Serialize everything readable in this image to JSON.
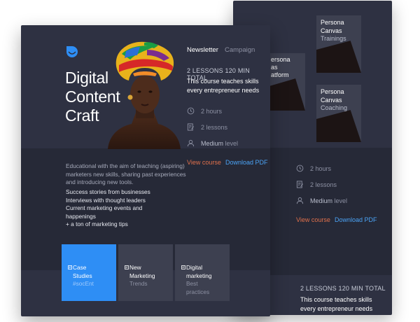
{
  "back_card": {
    "thumbs": [
      {
        "lines": [
          "Persona",
          "Canvas"
        ],
        "sub": "Trainings"
      },
      {
        "lines": [
          "Persona",
          "Canvas"
        ],
        "sub": "Coaching"
      }
    ],
    "partial_thumb": {
      "lines": [
        "ersona",
        "as",
        "atform"
      ]
    },
    "meta": {
      "hours": "2 hours",
      "lessons": "2 lessons",
      "level_prefix": "Medium",
      "level_suffix": "level"
    },
    "links": {
      "view": "View course",
      "download": "Download PDF"
    },
    "info": {
      "label": "2 LESSONS 120 MIN TOTAL",
      "text": "This course teaches skills every entrepreneur needs"
    }
  },
  "front_card": {
    "title": "Digital Content Craft",
    "tabs": [
      {
        "label": "Newsletter",
        "active": true
      },
      {
        "label": "Campaign",
        "active": false
      }
    ],
    "info": {
      "label": "2 LESSONS 120 MIN TOTAL",
      "text": "This course teaches skills every entrepreneur needs"
    },
    "meta": {
      "hours": "2 hours",
      "lessons": "2 lessons",
      "level_prefix": "Medium",
      "level_suffix": "level"
    },
    "links": {
      "view": "View course",
      "download": "Download PDF"
    },
    "description": "Educational with the aim of teaching (aspiring) marketers new skills, sharing past experiences and introducing new tools.",
    "bullets": [
      "Success stories from businesses",
      "Interviews with thought leaders",
      "Current marketing events and",
      "happenings",
      "+ a ton of marketing tips"
    ],
    "tiles": [
      {
        "lines": [
          "Case",
          "Studies"
        ],
        "sub": "#socEnt",
        "active": true
      },
      {
        "lines": [
          "New",
          "Marketing"
        ],
        "sub": "Trends",
        "active": false
      },
      {
        "lines": [
          "Digital",
          "marketing"
        ],
        "sub": "Best practices",
        "active": false
      }
    ]
  },
  "colors": {
    "card_bg": "#2e3142",
    "band_bg": "#262937",
    "tile_bg": "#3d4050",
    "accent_blue": "#2e8ef5",
    "link_orange": "#e0704b",
    "link_blue": "#4ba3f5"
  },
  "icons": {
    "logo": "smile-logo-icon",
    "hours": "clock-icon",
    "lessons": "document-edit-icon",
    "level": "user-icon",
    "tile": "document-icon"
  }
}
